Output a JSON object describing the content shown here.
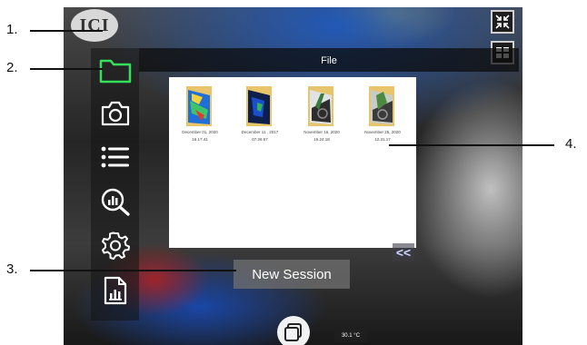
{
  "logo": {
    "text": "ICI"
  },
  "file_panel": {
    "title": "File",
    "files": [
      {
        "date": "December 01, 2020",
        "time": "16.17.41"
      },
      {
        "date": "December 11 , 2017",
        "time": "07.26.57"
      },
      {
        "date": "November 16, 2020",
        "time": "16.24.18"
      },
      {
        "date": "November 25, 2020",
        "time": "12.31.17"
      }
    ],
    "collapse_label": "<<"
  },
  "sidebar": {
    "items": [
      {
        "icon": "folder-icon",
        "active": true
      },
      {
        "icon": "camera-icon",
        "active": false
      },
      {
        "icon": "list-icon",
        "active": false
      },
      {
        "icon": "analysis-icon",
        "active": false
      },
      {
        "icon": "gear-icon",
        "active": false
      },
      {
        "icon": "report-icon",
        "active": false
      }
    ]
  },
  "new_session": {
    "label": "New Session"
  },
  "temperature": {
    "value": "30.1 °C"
  },
  "callouts": [
    "1.",
    "2.",
    "3.",
    "4."
  ],
  "colors": {
    "accent": "#35e05a",
    "panel_bg": "#ffffff",
    "topbar_bg": "#141414"
  }
}
